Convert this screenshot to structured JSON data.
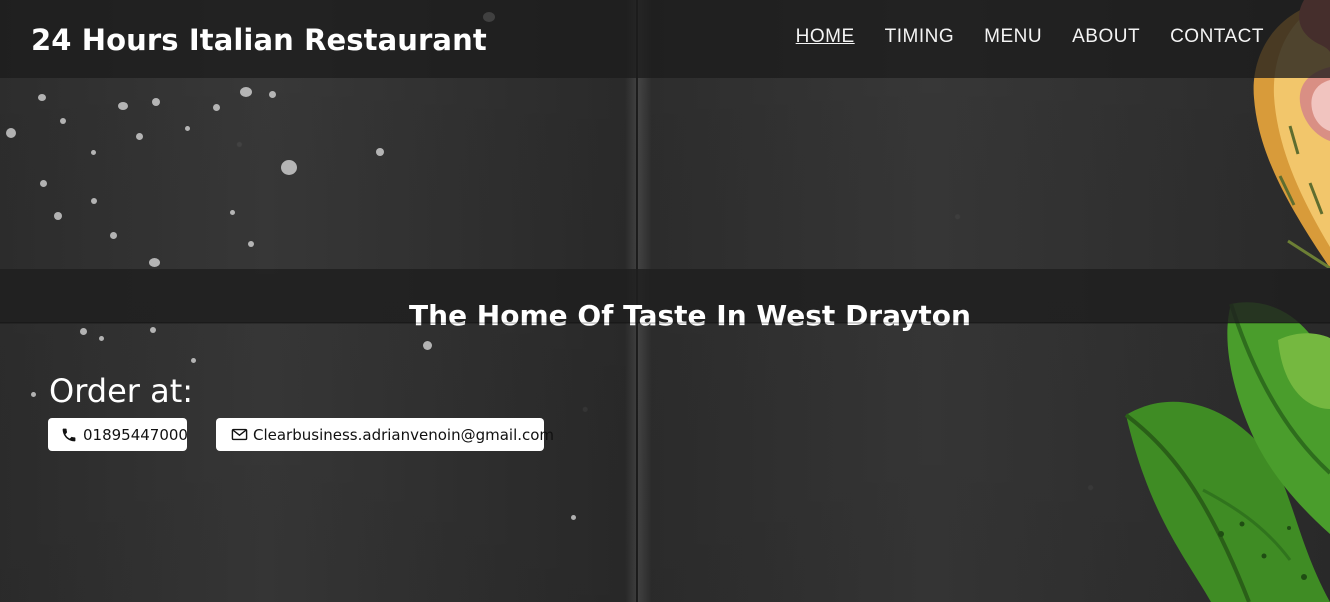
{
  "header": {
    "brand": "24 Hours Italian Restaurant",
    "nav": [
      {
        "label": "HOME",
        "active": true
      },
      {
        "label": "TIMING",
        "active": false
      },
      {
        "label": "MENU",
        "active": false
      },
      {
        "label": "ABOUT",
        "active": false
      },
      {
        "label": "CONTACT",
        "active": false
      }
    ]
  },
  "hero": {
    "tagline": "The Home Of Taste In West Drayton"
  },
  "order": {
    "title": "Order at:",
    "phone": "01895447000",
    "email": "Clearbusiness.adrianvenoin@gmail.com"
  },
  "icons": {
    "phone": "phone-icon",
    "email": "envelope-icon"
  },
  "colors": {
    "header_overlay": "#1c1c1c",
    "band_overlay": "#1e1e1e",
    "text": "#ffffff",
    "button_bg": "#ffffff"
  }
}
